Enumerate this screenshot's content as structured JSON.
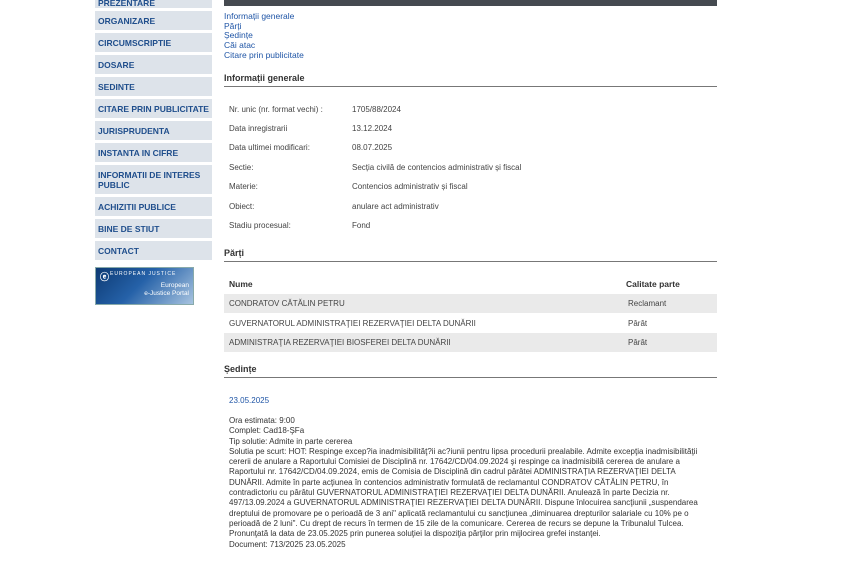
{
  "sidebar": {
    "items": [
      {
        "label": "PREZENTARE"
      },
      {
        "label": "ORGANIZARE"
      },
      {
        "label": "CIRCUMSCRIPTIE"
      },
      {
        "label": "DOSARE"
      },
      {
        "label": "SEDINTE"
      },
      {
        "label": "CITARE PRIN PUBLICITATE"
      },
      {
        "label": "JURISPRUDENTA"
      },
      {
        "label": "INSTANTA IN CIFRE"
      },
      {
        "label": "INFORMATII DE INTERES PUBLIC"
      },
      {
        "label": "ACHIZITII PUBLICE"
      },
      {
        "label": "BINE DE STIUT"
      },
      {
        "label": "CONTACT"
      }
    ],
    "ejustice": {
      "top": "EUROPEAN JUSTICE",
      "line1": "European",
      "line2": "e-Justice Portal"
    }
  },
  "anchors": [
    "Informații generale",
    "Părți",
    "Ședințe",
    "Căi atac",
    "Citare prin publicitate"
  ],
  "general": {
    "title": "Informații generale",
    "fields": [
      {
        "label": "Nr. unic (nr. format vechi) :",
        "value": "1705/88/2024"
      },
      {
        "label": "Data inregistrarii",
        "value": "13.12.2024"
      },
      {
        "label": "Data ultimei modificari:",
        "value": "08.07.2025"
      },
      {
        "label": "Sectie:",
        "value": "Secția civilă de contencios administrativ și fiscal"
      },
      {
        "label": "Materie:",
        "value": "Contencios administrativ și fiscal"
      },
      {
        "label": "Obiect:",
        "value": "anulare act administrativ"
      },
      {
        "label": "Stadiu procesual:",
        "value": "Fond"
      }
    ]
  },
  "parties": {
    "title": "Părți",
    "headers": {
      "name": "Nume",
      "role": "Calitate parte"
    },
    "rows": [
      {
        "name": "CONDRATOV CĂTĂLIN PETRU",
        "role": "Reclamant"
      },
      {
        "name": "GUVERNATORUL ADMINISTRAŢIEI REZERVAŢIEI DELTA DUNĂRII",
        "role": "Pârât"
      },
      {
        "name": "ADMINISTRAŢIA REZERVAŢIEI BIOSFEREI DELTA DUNĂRII",
        "role": "Pârât"
      }
    ]
  },
  "hearings": {
    "title": "Ședințe",
    "date": "23.05.2025",
    "lines": [
      "Ora estimata: 9:00",
      "Complet: Cad18-ŞFa",
      "Tip solutie: Admite in parte cererea",
      "Solutia pe scurt: HOT: Respinge excep?ia inadmisibilităţ?ii ac?iunii pentru lipsa procedurii prealabile. Admite excepţia inadmisibilităţii cererii de anulare a Raportului Comisiei de Disciplină nr. 17642/CD/04.09.2024 şi respinge ca inadmisibilă cererea de anulare a Raportului nr. 17642/CD/04.09.2024, emis de Comisia de Disciplină din cadrul pârâtei ADMINISTRAŢIA REZERVAŢIEI DELTA DUNĂRII. Admite în parte acţiunea în contencios administrativ formulată de reclamantul CONDRATOV CĂTĂLIN PETRU, în contradictoriu cu pârâtul GUVERNATORUL ADMINISTRAŢIEI REZERVAŢIEI DELTA DUNĂRII. Anulează în parte Decizia nr. 497/13.09.2024 a GUVERNATORUL ADMINISTRAŢIEI REZERVAŢIEI DELTA DUNĂRII. Dispune înlocuirea sancţiunii „suspendarea dreptului de promovare pe o perioadă de 3 ani\" aplicată reclamantului cu sancţiunea „diminuarea drepturilor salariale cu 10% pe o perioadă de 2 luni\". Cu drept de recurs în termen de 15 zile de la comunicare. Cererea de recurs se depune la Tribunalul Tulcea. Pronunţată la data de 23.05.2025 prin punerea soluţiei la dispoziţia părţilor prin mijlocirea grefei instanţei.",
      "Document:    713/2025  23.05.2025"
    ]
  }
}
